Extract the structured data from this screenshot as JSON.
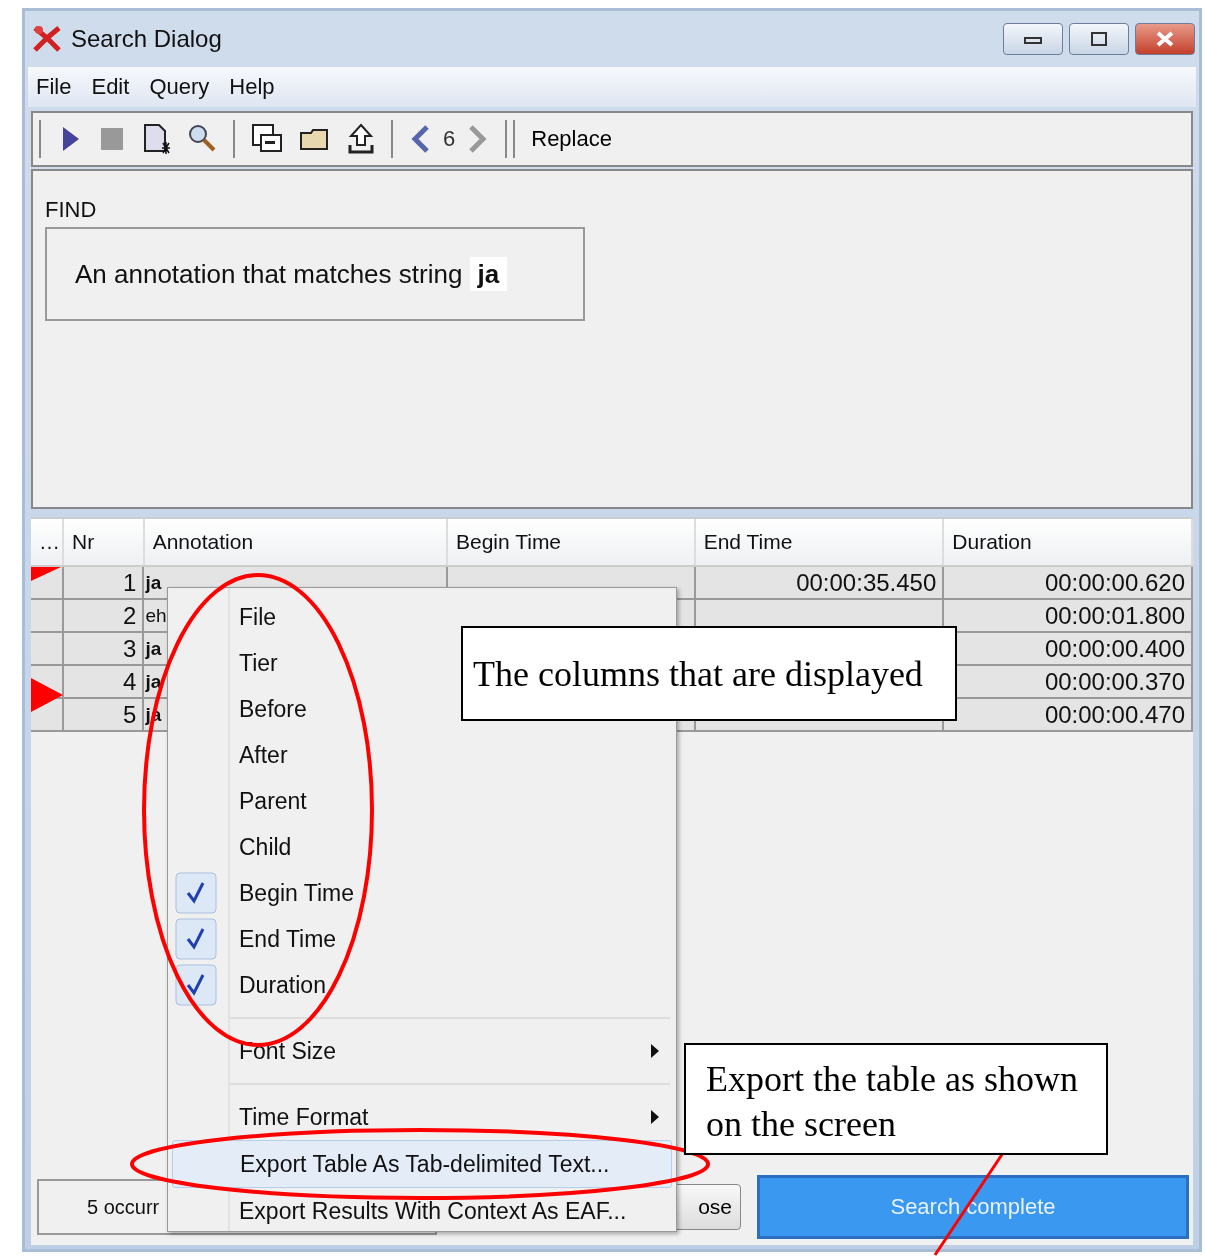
{
  "window": {
    "title": "Search Dialog"
  },
  "menu_bar": [
    "File",
    "Edit",
    "Query",
    "Help"
  ],
  "toolbar": {
    "history_count": "6",
    "replace_button": "Replace"
  },
  "find": {
    "label": "FIND",
    "query": "An annotation that matches string **ja**"
  },
  "table": {
    "columns": [
      "…",
      "Nr",
      "Annotation",
      "Begin Time",
      "End Time",
      "Duration"
    ],
    "rows": [
      {
        "nr": "1",
        "annotation": "ja",
        "match": true,
        "end_time": "00:00:35.450",
        "duration": "00:00:00.620",
        "flagged": true,
        "current": false
      },
      {
        "nr": "2",
        "annotation": "eh",
        "match": false,
        "duration": "00:00:01.800",
        "flagged": false,
        "current": false
      },
      {
        "nr": "3",
        "annotation": "ja",
        "match": true,
        "duration": "00:00:00.400",
        "flagged": false,
        "current": false
      },
      {
        "nr": "4",
        "annotation": "ja",
        "match": true,
        "duration": "00:00:00.370",
        "flagged": false,
        "current": true
      },
      {
        "nr": "5",
        "annotation": "ja",
        "match": true,
        "duration": "00:00:00.470",
        "flagged": false,
        "current": false
      }
    ]
  },
  "context_menu": [
    {
      "kind": "check",
      "label": "File",
      "checked": false
    },
    {
      "kind": "check",
      "label": "Tier",
      "checked": false
    },
    {
      "kind": "check",
      "label": "Before",
      "checked": false
    },
    {
      "kind": "check",
      "label": "After",
      "checked": false
    },
    {
      "kind": "check",
      "label": "Parent",
      "checked": false
    },
    {
      "kind": "check",
      "label": "Child",
      "checked": false
    },
    {
      "kind": "check",
      "label": "Begin Time",
      "checked": true
    },
    {
      "kind": "check",
      "label": "End Time",
      "checked": true
    },
    {
      "kind": "check",
      "label": "Duration",
      "checked": true
    },
    {
      "kind": "separator"
    },
    {
      "kind": "submenu",
      "label": "Font Size"
    },
    {
      "kind": "separator"
    },
    {
      "kind": "submenu",
      "label": "Time Format"
    },
    {
      "kind": "action",
      "label": "Export Table As Tab-delimited Text...",
      "selected": true
    },
    {
      "kind": "action",
      "label": "Export Results With Context As EAF...",
      "selected": false
    }
  ],
  "callouts": [
    "The columns that are displayed",
    "Export the table as shown on the screen"
  ],
  "status": "5 occurr",
  "close_button": "ose",
  "search_button": "Search complete"
}
